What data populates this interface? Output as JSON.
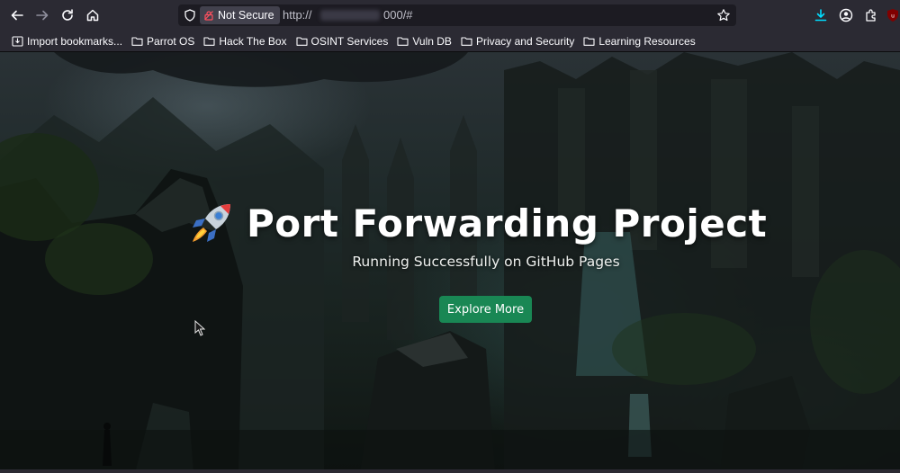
{
  "browser": {
    "security_label": "Not Secure",
    "url_prefix": "http://",
    "url_suffix": "000/#",
    "icons": {
      "back": "arrow-left-icon",
      "forward": "arrow-right-icon",
      "reload": "reload-icon",
      "home": "home-icon",
      "shield": "shield-icon",
      "insecure": "broken-lock-icon",
      "bookmark": "star-icon",
      "downloads": "download-icon",
      "account": "account-icon",
      "extensions": "puzzle-icon",
      "ublock": "shield-extension-icon"
    }
  },
  "bookmarks": [
    {
      "label": "Import bookmarks...",
      "icon": "import-icon"
    },
    {
      "label": "Parrot OS",
      "icon": "folder-icon"
    },
    {
      "label": "Hack The Box",
      "icon": "folder-icon"
    },
    {
      "label": "OSINT Services",
      "icon": "folder-icon"
    },
    {
      "label": "Vuln DB",
      "icon": "folder-icon"
    },
    {
      "label": "Privacy and Security",
      "icon": "folder-icon"
    },
    {
      "label": "Learning Resources",
      "icon": "folder-icon"
    }
  ],
  "hero": {
    "title": "Port Forwarding Project",
    "title_icon": "rocket-icon",
    "subtitle": "Running Successfully on GitHub Pages",
    "button_label": "Explore More"
  },
  "colors": {
    "toolbar": "#2b2a33",
    "urlbar": "#1c1b22",
    "button": "#198754",
    "download_icon": "#0df",
    "ublock_icon": "#800000"
  }
}
